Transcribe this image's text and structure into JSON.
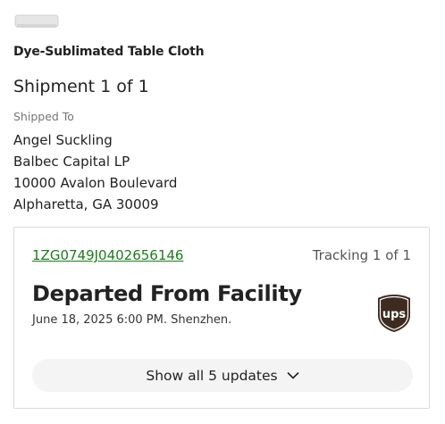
{
  "product": {
    "name": "Dye-Sublimated Table Cloth",
    "image_icon": "table-cloth-thumbnail"
  },
  "shipment": {
    "title": "Shipment 1 of 1",
    "shipped_to_label": "Shipped To",
    "address": {
      "name": "Angel Suckling",
      "company": "Balbec Capital LP",
      "street": "10000 Avalon Boulevard",
      "city_state_zip": "Alpharetta, GA 30009"
    }
  },
  "tracking": {
    "number": "1ZG0749J0402656146",
    "count_label": "Tracking 1 of 1",
    "status": "Departed From Facility",
    "detail": "June 18, 2025 6:00 PM. Shenzhen.",
    "carrier": "ups",
    "carrier_icon": "ups-logo-icon",
    "show_updates_label": "Show all 5 updates",
    "chevron_icon": "chevron-down-icon"
  },
  "colors": {
    "link": "#1a7d1a",
    "ups_brown": "#3d2b1f",
    "ups_gold": "#ffb500"
  }
}
